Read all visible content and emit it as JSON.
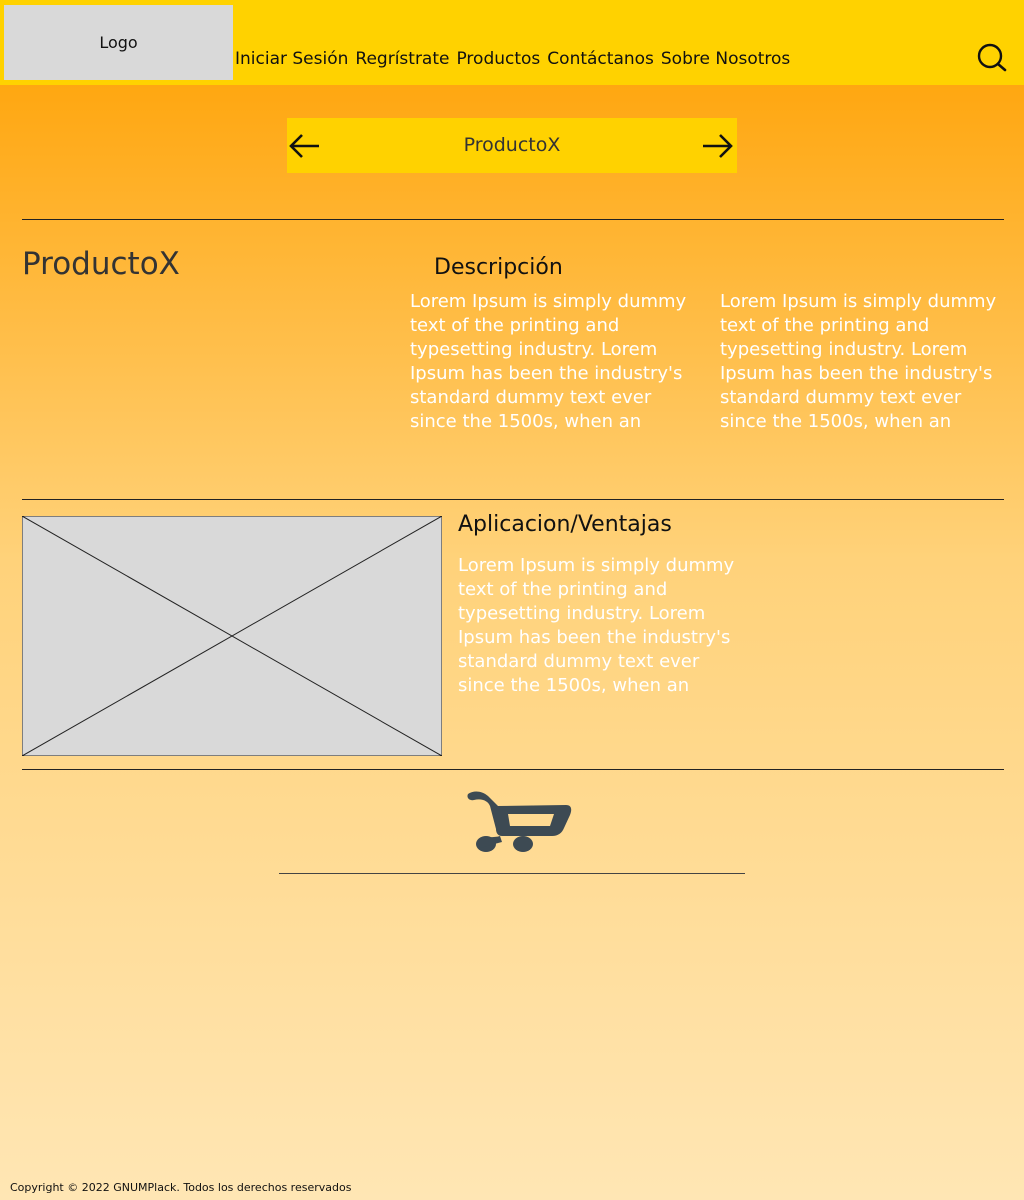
{
  "header": {
    "logo": "Logo",
    "nav": [
      "Iniciar Sesión",
      "Regrístrate",
      "Productos",
      "Contáctanos",
      "Sobre Nosotros"
    ],
    "search_icon": "search-icon"
  },
  "carousel": {
    "title": "ProductoX",
    "prev_icon": "arrow-left-icon",
    "next_icon": "arrow-right-icon"
  },
  "product": {
    "name": "ProductoX",
    "description_title": "Descripción",
    "description_col1": "Lorem Ipsum is simply dummy text of the printing and typesetting industry. Lorem Ipsum has been the industry's standard dummy text ever since the 1500s, when an",
    "description_col2": "Lorem Ipsum is simply dummy text of the printing and typesetting industry. Lorem Ipsum has been the industry's standard dummy text ever since the 1500s, when an"
  },
  "applications": {
    "title": "Aplicacion/Ventajas",
    "text": "Lorem Ipsum is simply dummy text of the printing and typesetting industry. Lorem Ipsum has been the industry's standard dummy text ever since the 1500s, when an"
  },
  "cart": {
    "icon": "cart-icon"
  },
  "footer": {
    "copyright": "Copyright © 2022 GNUMPlack. Todos los derechos reservados"
  },
  "colors": {
    "header": "#ffd200",
    "page_top": "#ffa711",
    "page_bottom": "#ffe6b4",
    "placeholder": "#d9d9d9",
    "cart": "#3d4a53"
  }
}
